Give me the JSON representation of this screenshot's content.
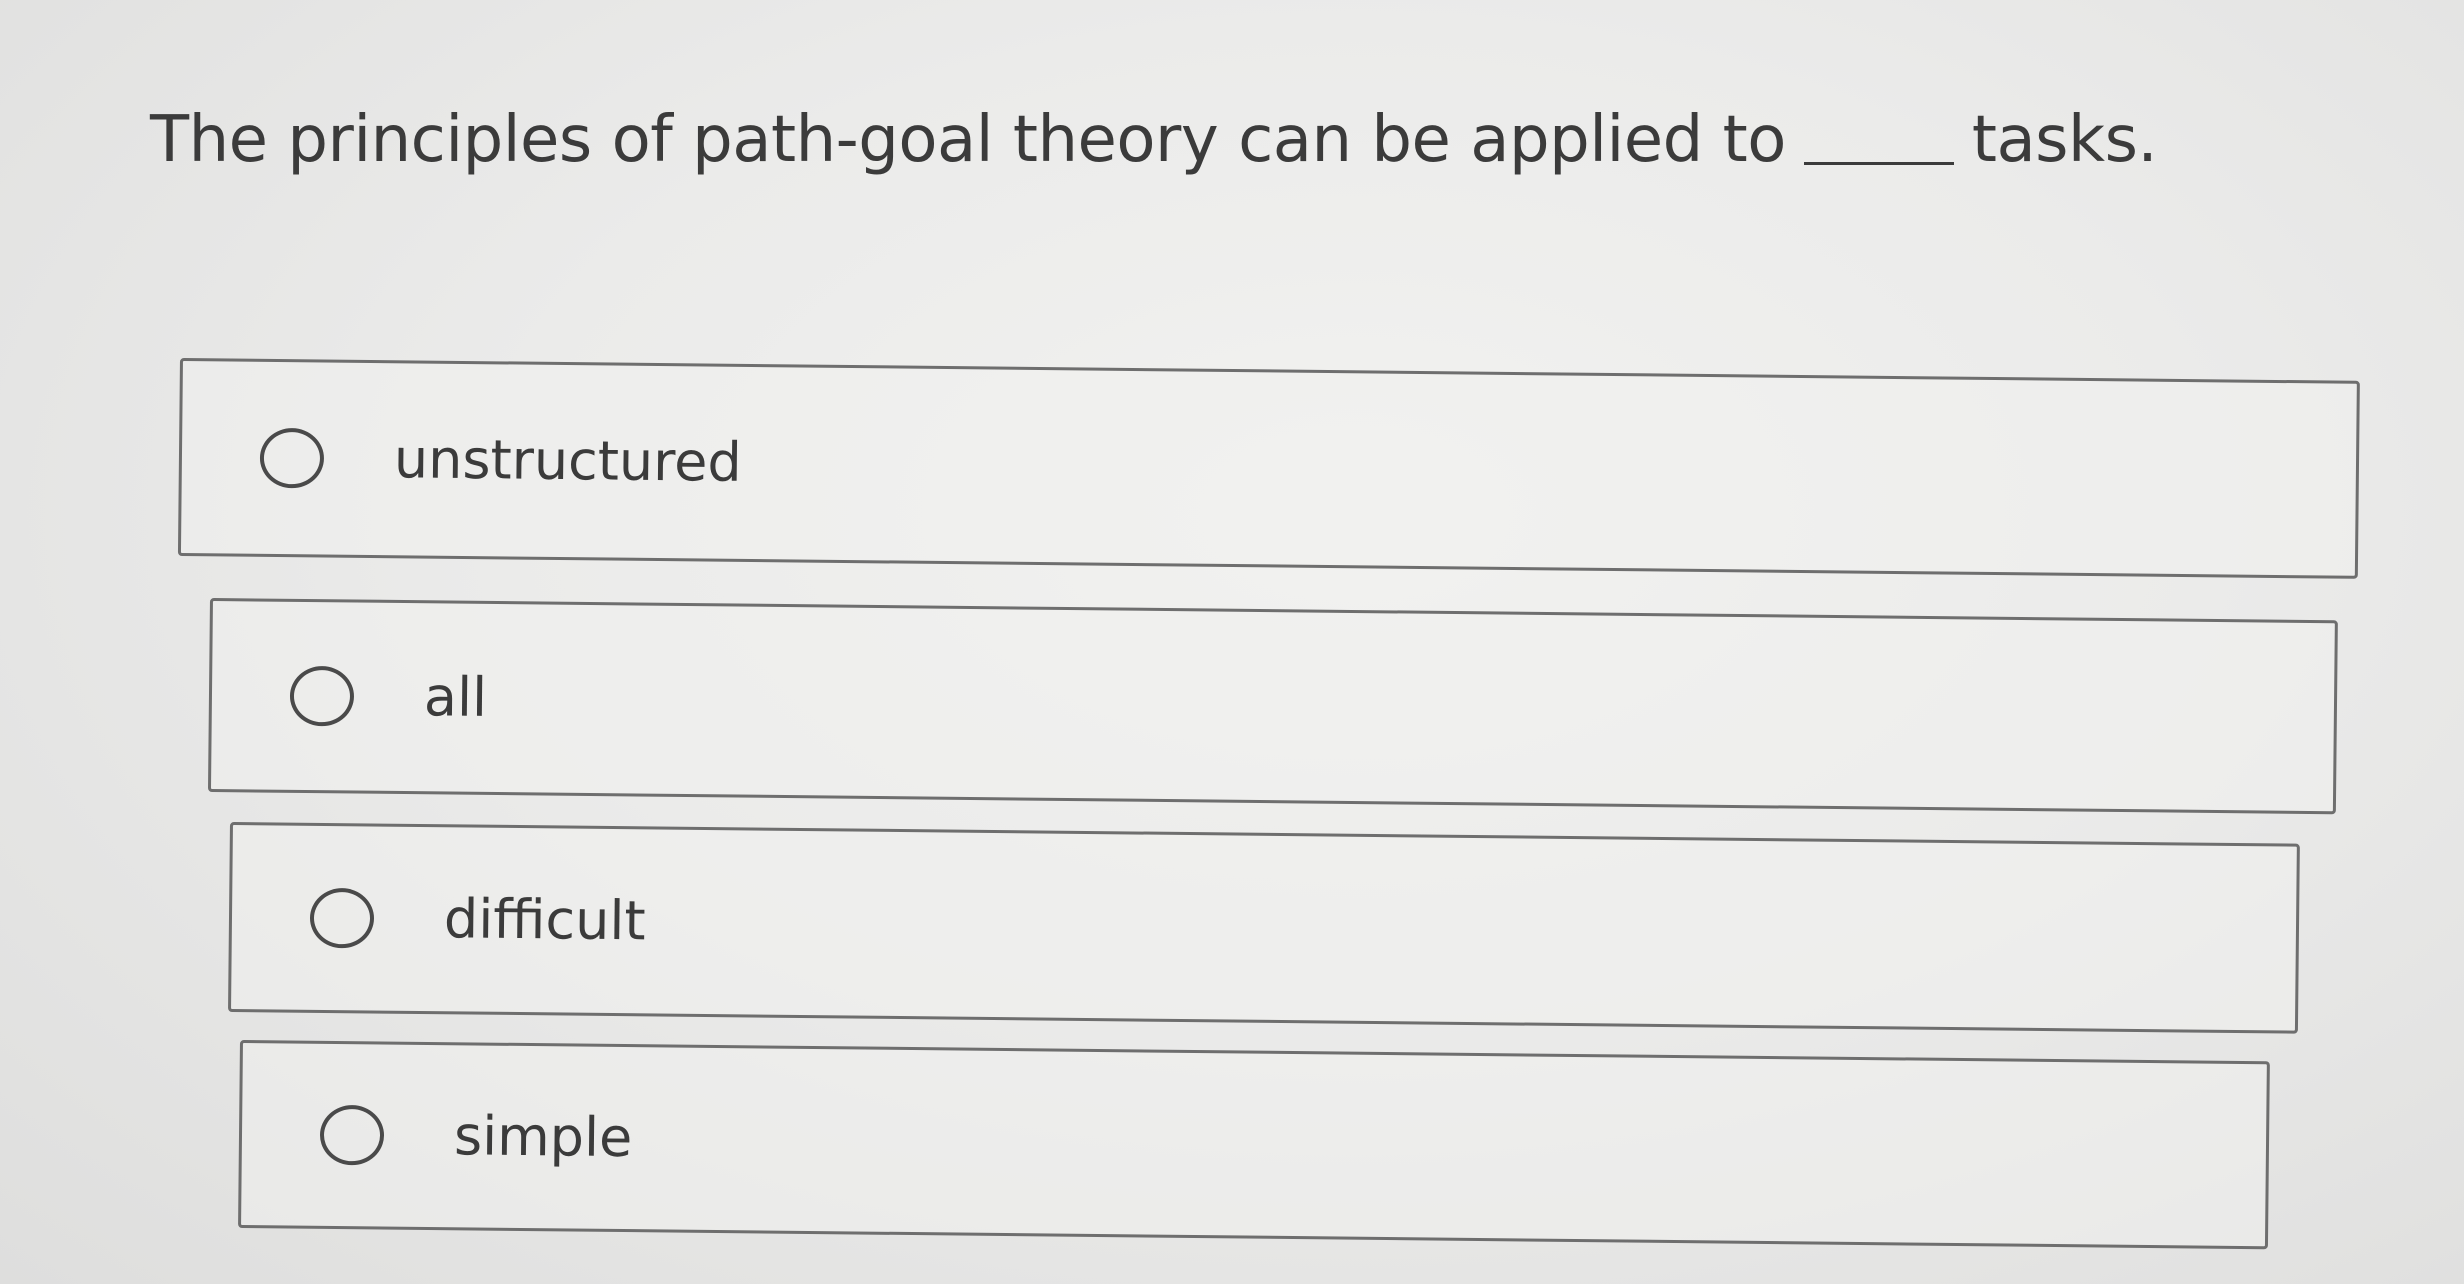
{
  "question": {
    "text_before": "The principles of path-goal theory can be applied to",
    "text_after": "tasks."
  },
  "options": [
    {
      "label": "unstructured",
      "selected": false
    },
    {
      "label": "all",
      "selected": false
    },
    {
      "label": "difficult",
      "selected": false
    },
    {
      "label": "simple",
      "selected": false
    }
  ]
}
